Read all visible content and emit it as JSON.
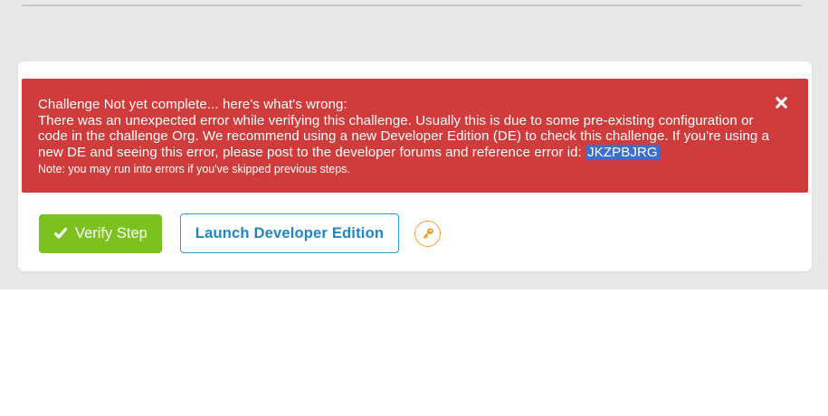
{
  "theme": {
    "gray_section_bg": "#e8e8e8",
    "divider_color": "#c6c6c6",
    "card_bg": "#ffffff",
    "alert_bg": "#d03c3c",
    "alert_text_color": "#ffffff",
    "error_id_highlight_bg": "#3a6fd1",
    "verify_button_green": "#7cc21e",
    "launch_button_border_blue": "#2b9ad3",
    "launch_button_text_blue": "#1d87c4",
    "key_icon_orange": "#ef9218"
  },
  "alert": {
    "title": "Challenge Not yet complete... here's what's wrong:",
    "body": "There was an unexpected error while verifying this challenge. Usually this is due to some pre-existing configuration or code in the challenge Org. We recommend using a new Developer Edition (DE) to check this challenge. If you're using a new DE and seeing this error, please post to the developer forums and reference error id: ",
    "error_id": "JKZPBJRG",
    "note": "Note: you may run into errors if you've skipped previous steps.",
    "close_icon": "close-icon"
  },
  "actions": {
    "verify_button": {
      "label": "Verify Step",
      "icon": "checkmark-icon"
    },
    "launch_button": {
      "label": "Launch Developer Edition"
    },
    "key_button": {
      "icon": "key-icon"
    }
  }
}
